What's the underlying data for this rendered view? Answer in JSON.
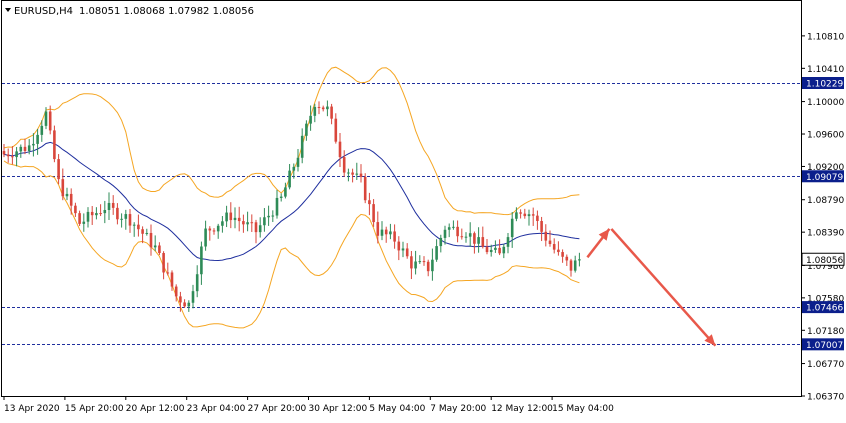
{
  "header": {
    "symbol": "EURUSD,H4",
    "ohlc": "1.08051 1.08068 1.07982 1.08056"
  },
  "colors": {
    "background": "#ffffff",
    "frame": "#000000",
    "grid": "#000000",
    "bull_candle": "#2e8b57",
    "bear_candle": "#d9463b",
    "bollinger": "#f5a623",
    "moving_average": "#1f2f9e",
    "level_line": "#1f2f9e",
    "level_label_bg": "#0b1f8c",
    "price_label_bg": "#ffffff",
    "forecast_arrow": "#e8584a"
  },
  "chart_data": {
    "type": "candlestick",
    "ylim": [
      1.0637,
      1.1124
    ],
    "y_ticks": [
      "1.10810",
      "1.10410",
      "1.10000",
      "1.09600",
      "1.09200",
      "1.08790",
      "1.08390",
      "1.07980",
      "1.07580",
      "1.07180",
      "1.06770",
      "1.06370"
    ],
    "x_ticks": [
      "13 Apr 2020",
      "15 Apr 20:00",
      "20 Apr 12:00",
      "23 Apr 04:00",
      "27 Apr 20:00",
      "30 Apr 12:00",
      "5 May 04:00",
      "7 May 20:00",
      "12 May 12:00",
      "15 May 04:00"
    ],
    "horizontal_levels": [
      {
        "label": "1.10229",
        "value": 1.10229
      },
      {
        "label": "1.09079",
        "value": 1.09079
      },
      {
        "label": "1.07466",
        "value": 1.07466
      },
      {
        "label": "1.07007",
        "value": 1.07007
      }
    ],
    "current_price": {
      "label": "1.08056",
      "value": 1.08056
    },
    "anchor_closes": [
      [
        0,
        1.0935
      ],
      [
        6,
        1.0945
      ],
      [
        10,
        1.0985
      ],
      [
        13,
        1.09
      ],
      [
        18,
        1.085
      ],
      [
        24,
        1.087
      ],
      [
        30,
        1.0855
      ],
      [
        36,
        1.082
      ],
      [
        41,
        1.076
      ],
      [
        44,
        1.075
      ],
      [
        48,
        1.084
      ],
      [
        54,
        1.086
      ],
      [
        60,
        1.084
      ],
      [
        66,
        1.088
      ],
      [
        70,
        1.0935
      ],
      [
        74,
        1.1
      ],
      [
        77,
        1.099
      ],
      [
        81,
        1.092
      ],
      [
        85,
        1.09
      ],
      [
        89,
        1.084
      ],
      [
        93,
        1.083
      ],
      [
        97,
        1.08
      ],
      [
        101,
        1.0795
      ],
      [
        105,
        1.0845
      ],
      [
        110,
        1.084
      ],
      [
        114,
        1.082
      ],
      [
        118,
        1.081
      ],
      [
        122,
        1.087
      ],
      [
        126,
        1.086
      ],
      [
        128,
        1.084
      ],
      [
        132,
        1.081
      ],
      [
        135,
        1.0795
      ],
      [
        137,
        1.0806
      ]
    ],
    "forecast_path": [
      [
        1.0808,
        1.0843
      ],
      [
        1.0843,
        1.0699
      ]
    ]
  }
}
